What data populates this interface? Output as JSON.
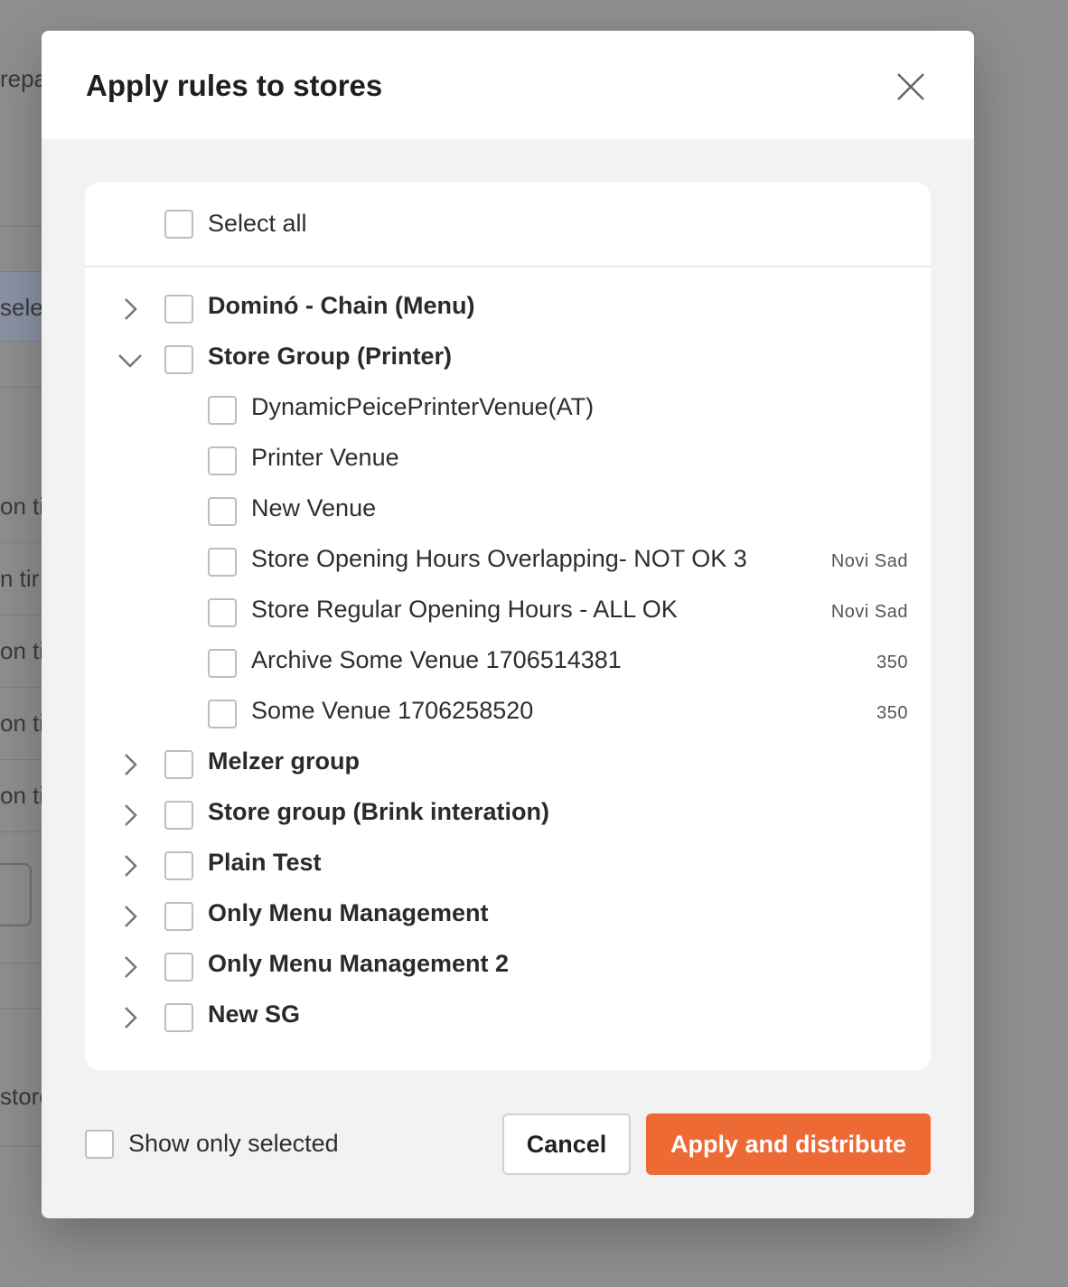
{
  "background": {
    "fragments": [
      "repa",
      "sele",
      "on tir",
      "n tir",
      "on tir",
      "on tir",
      "on tir",
      "store"
    ]
  },
  "modal": {
    "title": "Apply rules to stores",
    "select_all_label": "Select all",
    "groups": [
      {
        "label": "Dominó - Chain (Menu)",
        "expanded": false
      },
      {
        "label": "Store Group (Printer)",
        "expanded": true,
        "children": [
          {
            "label": "DynamicPeicePrinterVenue(AT)",
            "meta": ""
          },
          {
            "label": "Printer Venue",
            "meta": ""
          },
          {
            "label": "New Venue",
            "meta": ""
          },
          {
            "label": "Store Opening Hours Overlapping- NOT OK 3",
            "meta": "Novi Sad"
          },
          {
            "label": "Store Regular Opening Hours - ALL OK",
            "meta": "Novi Sad"
          },
          {
            "label": "Archive Some Venue 1706514381",
            "meta": "350"
          },
          {
            "label": "Some Venue 1706258520",
            "meta": "350"
          }
        ]
      },
      {
        "label": "Melzer group",
        "expanded": false
      },
      {
        "label": "Store group (Brink interation)",
        "expanded": false
      },
      {
        "label": "Plain Test",
        "expanded": false
      },
      {
        "label": "Only Menu Management",
        "expanded": false
      },
      {
        "label": "Only Menu Management 2",
        "expanded": false
      },
      {
        "label": "New SG",
        "expanded": false
      }
    ],
    "footer": {
      "show_only_selected_label": "Show only selected",
      "cancel_label": "Cancel",
      "apply_label": "Apply and distribute"
    }
  },
  "icons": {
    "close": "close-icon",
    "collapsed": "chevron-right-icon",
    "expanded": "chevron-down-icon"
  },
  "colors": {
    "accent": "#ee6a35",
    "overlay": "#8f8f8f"
  }
}
